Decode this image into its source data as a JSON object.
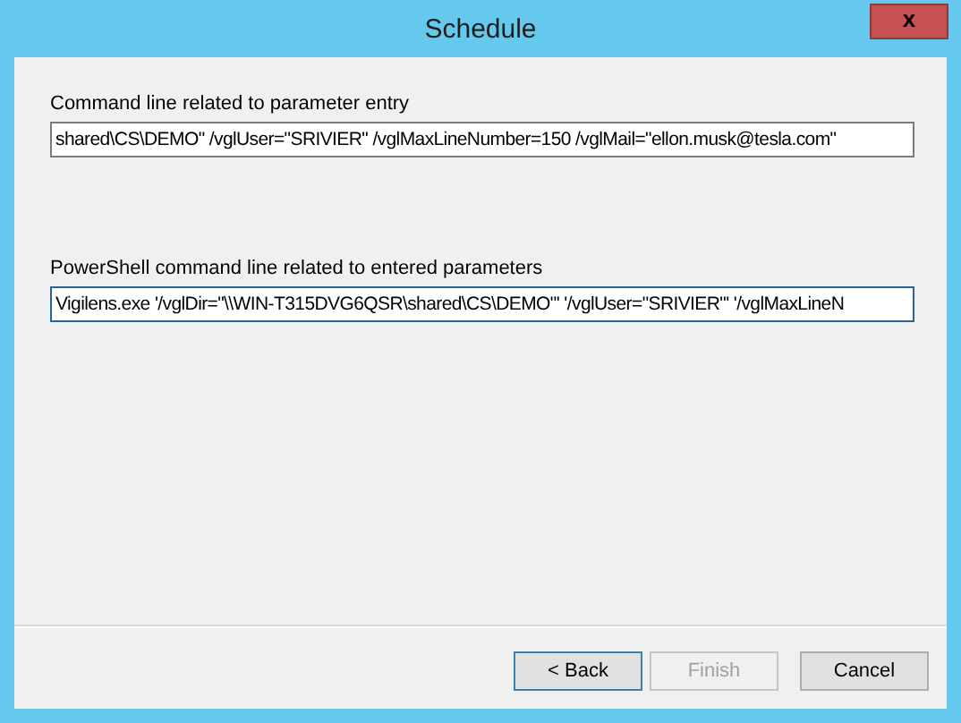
{
  "window": {
    "title": "Schedule",
    "close": "x"
  },
  "fields": [
    {
      "label": "Command line related to parameter entry",
      "value": "shared\\CS\\DEMO\" /vglUser=\"SRIVIER\" /vglMaxLineNumber=150 /vglMail=\"ellon.musk@tesla.com\"",
      "focused": false
    },
    {
      "label": "PowerShell command line related to entered parameters",
      "value": "Vigilens.exe '/vglDir=\"\\\\WIN-T315DVG6QSR\\shared\\CS\\DEMO\"' '/vglUser=\"SRIVIER\"' '/vglMaxLineN",
      "focused": true
    }
  ],
  "buttons": [
    {
      "label": "< Back",
      "disabled": false,
      "default": true
    },
    {
      "label": "Finish",
      "disabled": true,
      "default": false
    },
    {
      "label": "Cancel",
      "disabled": false,
      "default": false
    }
  ]
}
